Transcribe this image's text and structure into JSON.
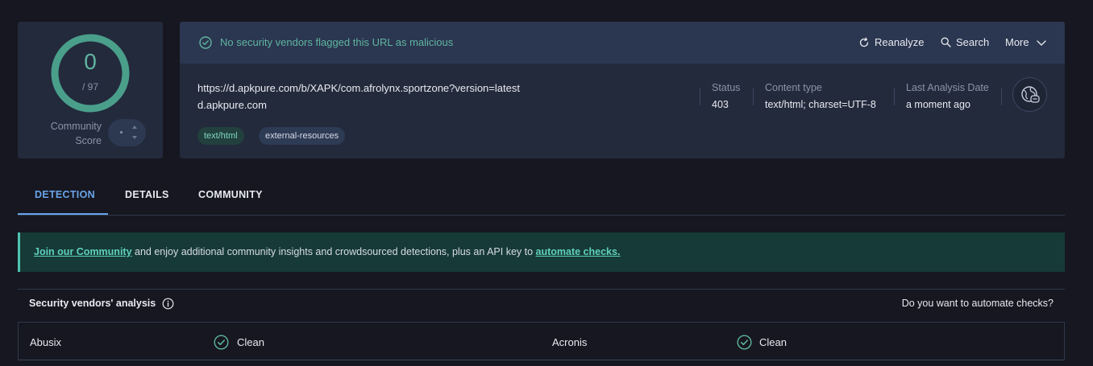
{
  "score": {
    "detections": "0",
    "total": "/ 97",
    "community_label_line1": "Community",
    "community_label_line2": "Score",
    "ring_color": "#4a9f8b",
    "fraction": 0
  },
  "header": {
    "status_message": "No security vendors flagged this URL as malicious",
    "actions": {
      "reanalyze": "Reanalyze",
      "search": "Search",
      "more": "More"
    }
  },
  "target": {
    "url": "https://d.apkpure.com/b/XAPK/com.afrolynx.sportzone?version=latest",
    "domain": "d.apkpure.com",
    "tags": [
      "text/html",
      "external-resources"
    ]
  },
  "meta": {
    "status": {
      "label": "Status",
      "value": "403"
    },
    "content_type": {
      "label": "Content type",
      "value": "text/html; charset=UTF-8"
    },
    "last_analysis": {
      "label": "Last Analysis Date",
      "value": "a moment ago"
    }
  },
  "tabs": [
    {
      "label": "DETECTION",
      "active": true
    },
    {
      "label": "DETAILS",
      "active": false
    },
    {
      "label": "COMMUNITY",
      "active": false
    }
  ],
  "banner": {
    "link1": "Join our Community",
    "middle": " and enjoy additional community insights and crowdsourced detections, plus an API key to ",
    "link2": "automate checks."
  },
  "vendors": {
    "title": "Security vendors' analysis",
    "automate_question": "Do you want to automate checks?",
    "rows": [
      {
        "left": {
          "name": "Abusix",
          "result": "Clean"
        },
        "right": {
          "name": "Acronis",
          "result": "Clean"
        }
      }
    ]
  },
  "colors": {
    "accent_green": "#5fb5a0",
    "accent_blue": "#6aa4ea",
    "banner_bg": "#163a37"
  }
}
